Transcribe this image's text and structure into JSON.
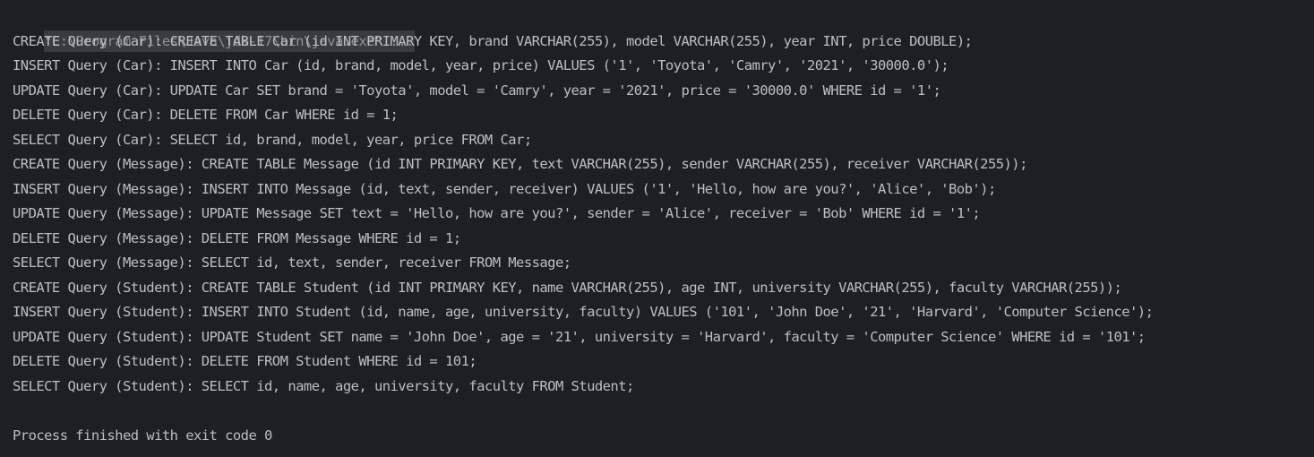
{
  "console": {
    "command": "\"C:\\Program Files\\Java\\jdk-17\\bin\\java.exe\" ...",
    "lines": [
      "CREATE Query (Car): CREATE TABLE Car (id INT PRIMARY KEY, brand VARCHAR(255), model VARCHAR(255), year INT, price DOUBLE);",
      "INSERT Query (Car): INSERT INTO Car (id, brand, model, year, price) VALUES ('1', 'Toyota', 'Camry', '2021', '30000.0');",
      "UPDATE Query (Car): UPDATE Car SET brand = 'Toyota', model = 'Camry', year = '2021', price = '30000.0' WHERE id = '1';",
      "DELETE Query (Car): DELETE FROM Car WHERE id = 1;",
      "SELECT Query (Car): SELECT id, brand, model, year, price FROM Car;",
      "CREATE Query (Message): CREATE TABLE Message (id INT PRIMARY KEY, text VARCHAR(255), sender VARCHAR(255), receiver VARCHAR(255));",
      "INSERT Query (Message): INSERT INTO Message (id, text, sender, receiver) VALUES ('1', 'Hello, how are you?', 'Alice', 'Bob');",
      "UPDATE Query (Message): UPDATE Message SET text = 'Hello, how are you?', sender = 'Alice', receiver = 'Bob' WHERE id = '1';",
      "DELETE Query (Message): DELETE FROM Message WHERE id = 1;",
      "SELECT Query (Message): SELECT id, text, sender, receiver FROM Message;",
      "CREATE Query (Student): CREATE TABLE Student (id INT PRIMARY KEY, name VARCHAR(255), age INT, university VARCHAR(255), faculty VARCHAR(255));",
      "INSERT Query (Student): INSERT INTO Student (id, name, age, university, faculty) VALUES ('101', 'John Doe', '21', 'Harvard', 'Computer Science');",
      "UPDATE Query (Student): UPDATE Student SET name = 'John Doe', age = '21', university = 'Harvard', faculty = 'Computer Science' WHERE id = '101';",
      "DELETE Query (Student): DELETE FROM Student WHERE id = 101;",
      "SELECT Query (Student): SELECT id, name, age, university, faculty FROM Student;"
    ],
    "exit_message": "Process finished with exit code 0"
  }
}
